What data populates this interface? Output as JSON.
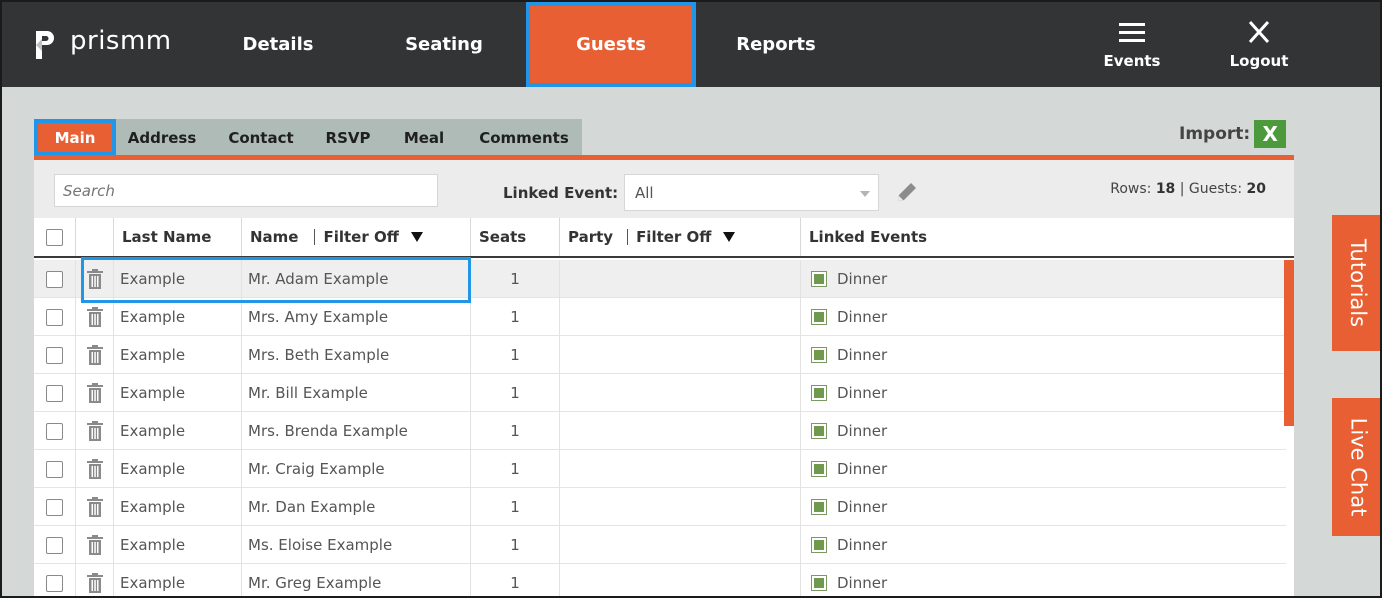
{
  "brand": {
    "name": "prismm"
  },
  "nav": {
    "items": [
      {
        "label": "Details"
      },
      {
        "label": "Seating"
      },
      {
        "label": "Guests"
      },
      {
        "label": "Reports"
      }
    ],
    "events_label": "Events",
    "logout_label": "Logout"
  },
  "subtabs": [
    "Main",
    "Address",
    "Contact",
    "RSVP",
    "Meal",
    "Comments"
  ],
  "import": {
    "label": "Import:",
    "icon": "excel-icon"
  },
  "toolbar": {
    "search_placeholder": "Search",
    "linked_event_label": "Linked Event:",
    "linked_event_value": "All",
    "rows_label": "Rows:",
    "rows_value": "18",
    "separator": "|",
    "guests_label": "Guests:",
    "guests_value": "20"
  },
  "table": {
    "headers": {
      "last_name": "Last Name",
      "name": "Name",
      "name_filter": "Filter Off",
      "seats": "Seats",
      "party": "Party",
      "party_filter": "Filter Off",
      "linked_events": "Linked Events"
    },
    "rows": [
      {
        "last_name": "Example",
        "name": "Mr. Adam Example",
        "seats": "1",
        "party": "",
        "event": "Dinner"
      },
      {
        "last_name": "Example",
        "name": "Mrs. Amy Example",
        "seats": "1",
        "party": "",
        "event": "Dinner"
      },
      {
        "last_name": "Example",
        "name": "Mrs. Beth Example",
        "seats": "1",
        "party": "",
        "event": "Dinner"
      },
      {
        "last_name": "Example",
        "name": "Mr. Bill Example",
        "seats": "1",
        "party": "",
        "event": "Dinner"
      },
      {
        "last_name": "Example",
        "name": "Mrs. Brenda Example",
        "seats": "1",
        "party": "",
        "event": "Dinner"
      },
      {
        "last_name": "Example",
        "name": "Mr. Craig Example",
        "seats": "1",
        "party": "",
        "event": "Dinner"
      },
      {
        "last_name": "Example",
        "name": "Mr. Dan Example",
        "seats": "1",
        "party": "",
        "event": "Dinner"
      },
      {
        "last_name": "Example",
        "name": "Ms. Eloise Example",
        "seats": "1",
        "party": "",
        "event": "Dinner"
      },
      {
        "last_name": "Example",
        "name": "Mr. Greg Example",
        "seats": "1",
        "party": "",
        "event": "Dinner"
      }
    ]
  },
  "side": {
    "tutorials": "Tutorials",
    "live_chat": "Live Chat"
  },
  "colors": {
    "accent": "#e85f34",
    "topbar": "#323436",
    "highlight": "#2196e8",
    "event_green": "#6f9a4e"
  }
}
